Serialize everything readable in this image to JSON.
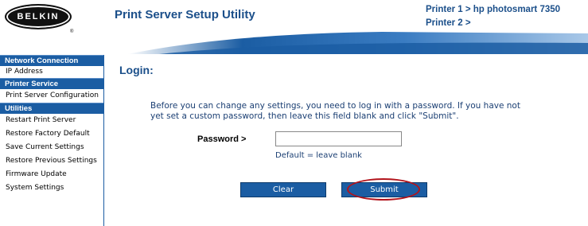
{
  "header": {
    "logo_text": "BELKIN",
    "logo_mark": "®",
    "title": "Print Server Setup Utility",
    "printers": [
      "Printer 1 > hp photosmart 7350",
      "Printer 2 >"
    ]
  },
  "sidebar": {
    "sections": [
      {
        "heading": "Network Connection",
        "items": [
          "IP Address"
        ]
      },
      {
        "heading": "Printer Service",
        "items": [
          "Print Server Configuration"
        ]
      },
      {
        "heading": "Utilities",
        "items": [
          "Restart Print Server",
          "Restore Factory Default",
          "Save Current Settings",
          "Restore Previous Settings",
          "Firmware Update",
          "System Settings"
        ]
      }
    ]
  },
  "main": {
    "title": "Login:",
    "instructions": "Before you can change any settings, you need to log in with a password. If you have not yet set a custom password, then leave this field blank and click \"Submit\".",
    "password_label": "Password >",
    "password_value": "",
    "password_hint": "Default = leave blank",
    "clear_label": "Clear",
    "submit_label": "Submit"
  },
  "colors": {
    "brand_blue": "#1b5da3",
    "title_blue": "#1b4f8a",
    "highlight_red": "#b2141c"
  }
}
